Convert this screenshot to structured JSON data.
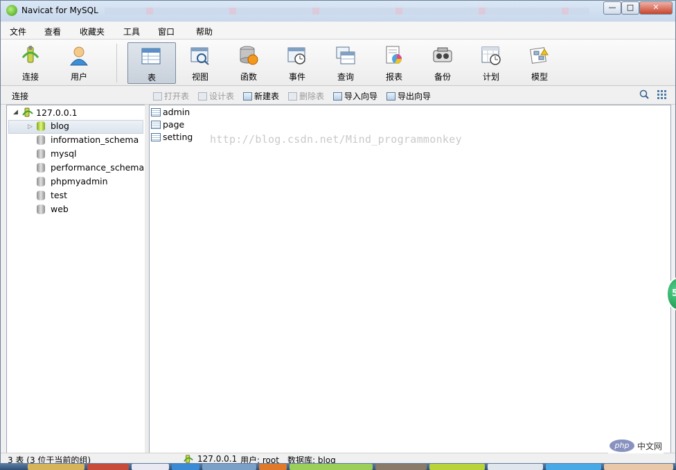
{
  "window": {
    "title": "Navicat for MySQL"
  },
  "window_controls": {
    "minimize": "—",
    "maximize": "□",
    "close": "✕"
  },
  "menu": [
    "文件",
    "查看",
    "收藏夹",
    "工具",
    "窗口",
    "帮助"
  ],
  "toolbar": [
    {
      "label": "连接",
      "icon": "connection-icon"
    },
    {
      "label": "用户",
      "icon": "user-icon"
    },
    {
      "label": "表",
      "icon": "table-icon",
      "active": true
    },
    {
      "label": "视图",
      "icon": "view-icon"
    },
    {
      "label": "函数",
      "icon": "function-icon"
    },
    {
      "label": "事件",
      "icon": "event-icon"
    },
    {
      "label": "查询",
      "icon": "query-icon"
    },
    {
      "label": "报表",
      "icon": "report-icon"
    },
    {
      "label": "备份",
      "icon": "backup-icon"
    },
    {
      "label": "计划",
      "icon": "schedule-icon"
    },
    {
      "label": "模型",
      "icon": "model-icon"
    }
  ],
  "object_bar": {
    "connection_label": "连接",
    "actions": [
      {
        "label": "打开表",
        "enabled": false
      },
      {
        "label": "设计表",
        "enabled": false
      },
      {
        "label": "新建表",
        "enabled": true
      },
      {
        "label": "删除表",
        "enabled": false
      },
      {
        "label": "导入向导",
        "enabled": true
      },
      {
        "label": "导出向导",
        "enabled": true
      }
    ]
  },
  "tree": {
    "server": "127.0.0.1",
    "databases": [
      {
        "name": "blog",
        "open": true,
        "selected": true
      },
      {
        "name": "information_schema"
      },
      {
        "name": "mysql"
      },
      {
        "name": "performance_schema"
      },
      {
        "name": "phpmyadmin"
      },
      {
        "name": "test"
      },
      {
        "name": "web"
      }
    ]
  },
  "tables": [
    "admin",
    "page",
    "setting"
  ],
  "watermark": "http://blog.csdn.net/Mind_programmonkey",
  "status": {
    "count": "3 表 (3 位于当前的组)",
    "server": "127.0.0.1",
    "user": "用户: root",
    "database": "数据库: blog"
  },
  "badge": {
    "text": "5"
  },
  "php_logo": {
    "logo": "php",
    "text": "中文网"
  },
  "colors": {
    "accent": "#7a8aa0",
    "selection": "#dbe3ec",
    "close": "#c7452d"
  }
}
